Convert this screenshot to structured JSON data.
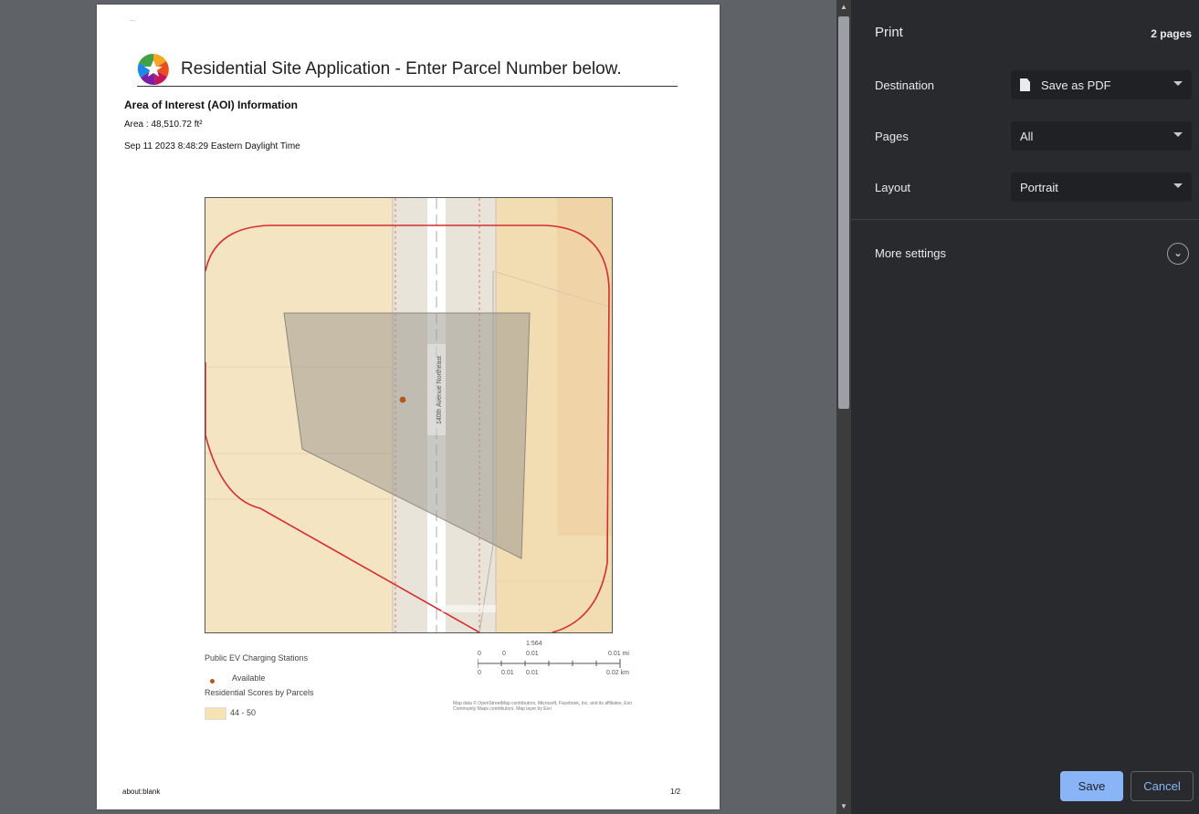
{
  "preview": {
    "app_title": "Residential Site Application - Enter Parcel Number below.",
    "aoi_heading": "Area of Interest (AOI) Information",
    "area": "Area : 48,510.72 ft²",
    "timestamp": "Sep 11 2023 8:48:29 Eastern Daylight Time",
    "street_label": "140th Avenue Northeast",
    "legend": {
      "ev_title": "Public EV Charging Stations",
      "ev_item": "Available",
      "parcel_title": "Residential Scores by Parcels",
      "parcel_item": "44 - 50"
    },
    "scale": {
      "ratio": "1:564",
      "top_ticks": [
        "0",
        "0",
        "0.01",
        "0.01 mi"
      ],
      "bottom_ticks": [
        "0",
        "0.01",
        "0.01",
        "0.02 km"
      ]
    },
    "attribution": "Map data © OpenStreetMap contributors, Microsoft, Facebook, Inc. and its affiliates, Esri Community Maps contributors, Map layer by Esri",
    "footer_url": "about:blank",
    "footer_page": "1/2"
  },
  "print_panel": {
    "title": "Print",
    "page_count": "2 pages",
    "destination_label": "Destination",
    "destination_value": "Save as PDF",
    "pages_label": "Pages",
    "pages_value": "All",
    "layout_label": "Layout",
    "layout_value": "Portrait",
    "more_settings": "More settings",
    "save_label": "Save",
    "cancel_label": "Cancel"
  },
  "colors": {
    "panel_bg": "#292a2d",
    "preview_bg": "#5f6368",
    "accent": "#8ab4f8",
    "aoi_outline": "#d32f2f",
    "parcel_fill": "#f6e3b4"
  },
  "icons": [
    "logo-icon",
    "pdf-file-icon",
    "dropdown-caret-icon",
    "chevron-down-icon",
    "ev-station-point-icon"
  ]
}
